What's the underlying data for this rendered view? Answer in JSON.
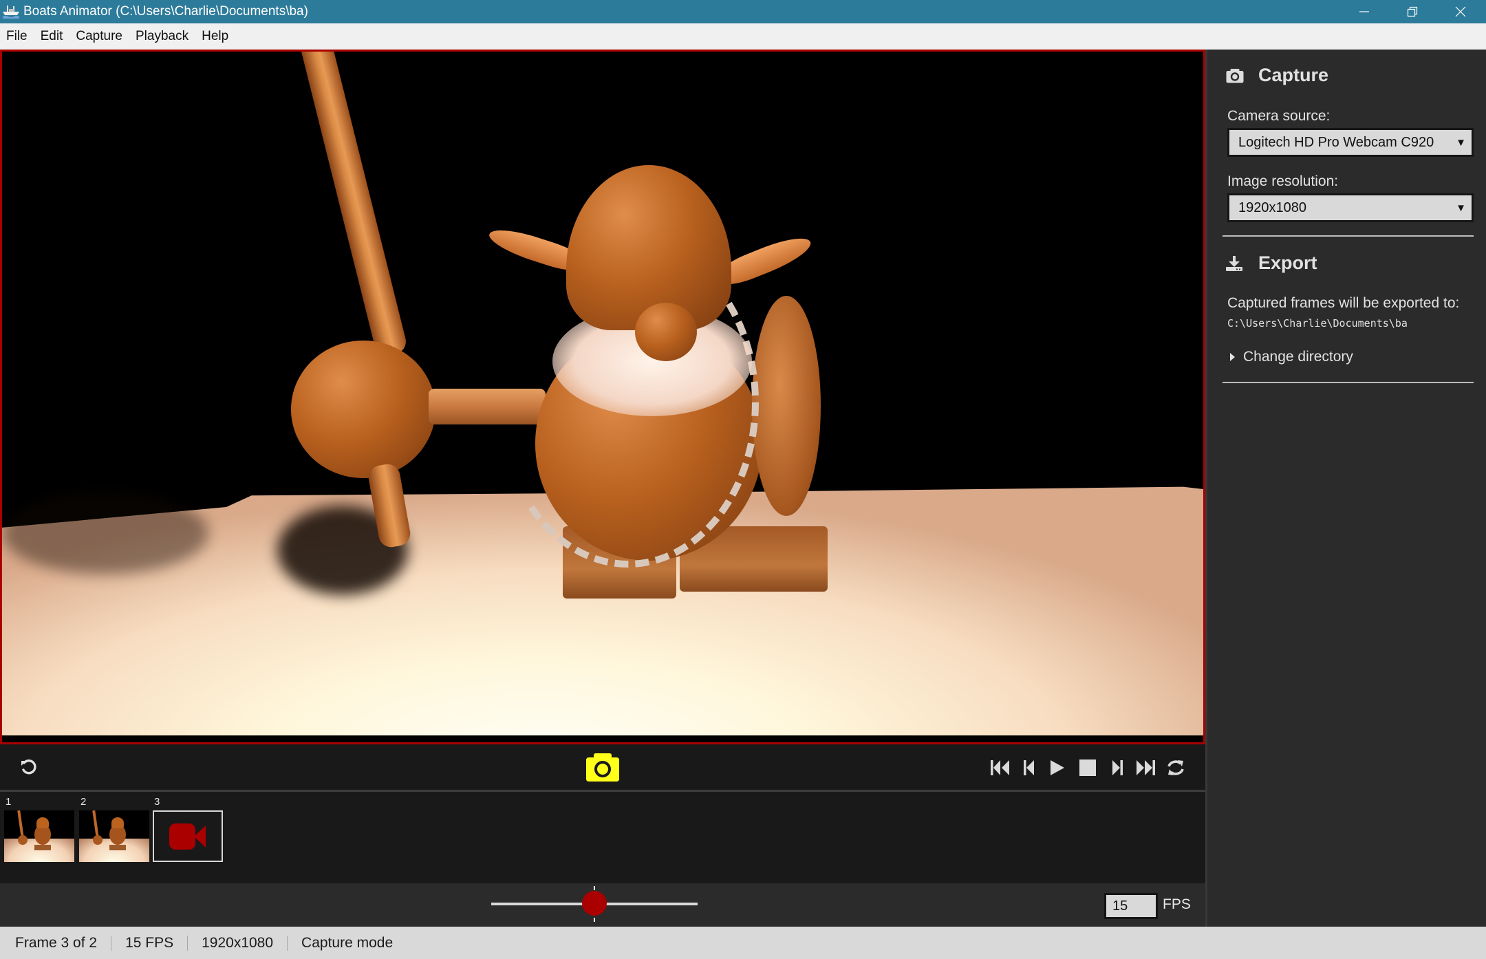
{
  "window": {
    "title": "Boats Animator (C:\\Users\\Charlie\\Documents\\ba)",
    "controls": [
      "minimize",
      "restore",
      "close"
    ]
  },
  "menu": {
    "items": [
      {
        "label": "File"
      },
      {
        "label": "Edit"
      },
      {
        "label": "Capture"
      },
      {
        "label": "Playback"
      },
      {
        "label": "Help"
      }
    ]
  },
  "toolbar": {
    "undo_icon": "undo-icon",
    "capture_icon": "camera-icon",
    "capture_color": "#ffff1a",
    "playback_buttons": [
      {
        "name": "first-frame",
        "icon": "skip-to-start-icon"
      },
      {
        "name": "previous-frame",
        "icon": "step-back-icon"
      },
      {
        "name": "play",
        "icon": "play-icon"
      },
      {
        "name": "stop",
        "icon": "stop-icon"
      },
      {
        "name": "next-frame",
        "icon": "step-forward-icon"
      },
      {
        "name": "last-frame",
        "icon": "skip-to-end-icon"
      },
      {
        "name": "loop",
        "icon": "loop-icon"
      }
    ]
  },
  "filmstrip": {
    "frames": [
      {
        "number": "1",
        "type": "captured"
      },
      {
        "number": "2",
        "type": "captured"
      },
      {
        "number": "3",
        "type": "live",
        "icon": "video-camera-icon"
      }
    ],
    "live_icon_color": "#aa0000"
  },
  "onion_skin": {
    "slider_value_fraction": 0.5
  },
  "fps": {
    "value": "15",
    "label": "FPS"
  },
  "status": {
    "frame": "Frame 3 of 2",
    "fps": "15 FPS",
    "resolution": "1920x1080",
    "mode": "Capture mode"
  },
  "panel": {
    "capture": {
      "title": "Capture",
      "icon": "camera-icon",
      "camera_label": "Camera source:",
      "camera_value": "Logitech HD Pro Webcam C920",
      "resolution_label": "Image resolution:",
      "resolution_value": "1920x1080"
    },
    "export": {
      "title": "Export",
      "icon": "download-icon",
      "description": "Captured frames will be exported to:",
      "path": "C:\\Users\\Charlie\\Documents\\ba",
      "change_directory": "Change directory"
    }
  },
  "colors": {
    "titlebar": "#2d7b9a",
    "accent_red": "#aa0000",
    "capture_yellow": "#ffff1a"
  }
}
